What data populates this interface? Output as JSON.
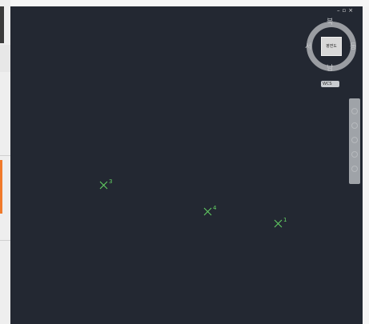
{
  "window_controls": {
    "minimize": "–",
    "restore": "▫",
    "close": "×"
  },
  "viewcube": {
    "face_label": "평면도",
    "north": "북",
    "south": "남",
    "west": "서",
    "east": "동",
    "wcs_label": "WCS"
  },
  "points": [
    {
      "label": "3"
    },
    {
      "label": "4"
    },
    {
      "label": "1"
    }
  ],
  "colors": {
    "viewport_background": "#232832",
    "point_marker": "#64d264",
    "accent_orange": "#f07a2a"
  }
}
